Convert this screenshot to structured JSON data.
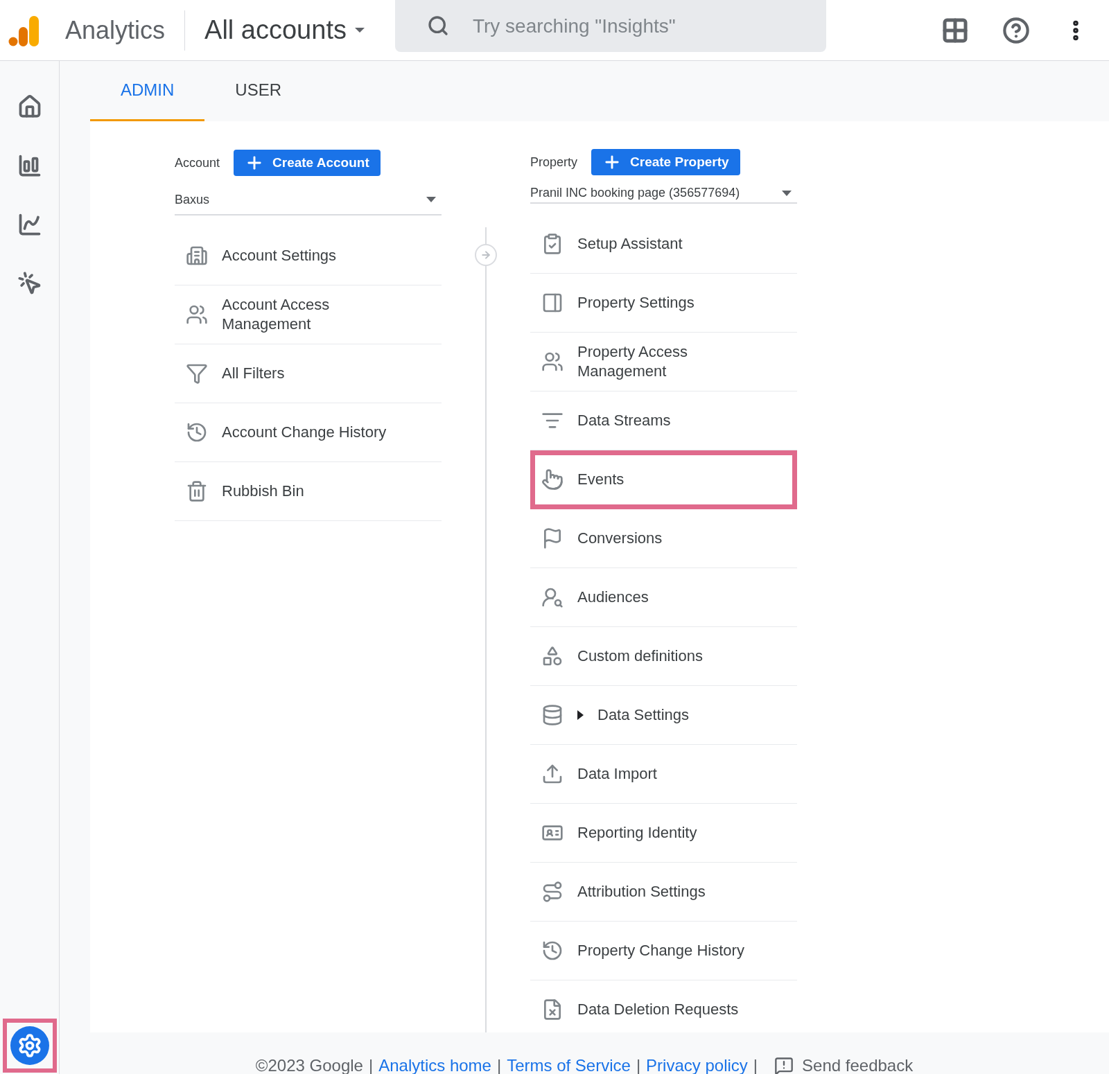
{
  "header": {
    "product": "Analytics",
    "account_picker": "All accounts",
    "search": {
      "placeholder": "Try searching \"Insights\""
    }
  },
  "sidebar": {
    "items": [
      {
        "kind": "home",
        "selected": false
      },
      {
        "kind": "reports",
        "selected": false
      },
      {
        "kind": "explore",
        "selected": false
      },
      {
        "kind": "advertising",
        "selected": false
      }
    ],
    "settings": {
      "selected": true,
      "highlighted": true
    }
  },
  "tabs": [
    {
      "label": "ADMIN",
      "selected": true
    },
    {
      "label": "USER",
      "selected": false
    }
  ],
  "account": {
    "label": "Account",
    "button": "Create Account",
    "selected_value": "Baxus",
    "items": [
      {
        "label": "Account Settings",
        "kind": "building",
        "highlighted": false
      },
      {
        "label": "Account Access Management",
        "kind": "people",
        "highlighted": false
      },
      {
        "label": "All Filters",
        "kind": "filter",
        "highlighted": false
      },
      {
        "label": "Account Change History",
        "kind": "history",
        "highlighted": false
      },
      {
        "label": "Rubbish Bin",
        "kind": "trash",
        "highlighted": false
      }
    ]
  },
  "property": {
    "label": "Property",
    "button": "Create Property",
    "selected_value": "Pranil INC booking page (356577694)",
    "items": [
      {
        "label": "Setup Assistant",
        "kind": "clipboard",
        "highlighted": false
      },
      {
        "label": "Property Settings",
        "kind": "layout",
        "highlighted": false
      },
      {
        "label": "Property Access Management",
        "kind": "people",
        "highlighted": false
      },
      {
        "label": "Data Streams",
        "kind": "streams",
        "highlighted": false
      },
      {
        "label": "Events",
        "kind": "touch",
        "highlighted": true
      },
      {
        "label": "Conversions",
        "kind": "flag",
        "highlighted": false
      },
      {
        "label": "Audiences",
        "kind": "audience",
        "highlighted": false
      },
      {
        "label": "Custom definitions",
        "kind": "shapes",
        "highlighted": false
      },
      {
        "label": "Data Settings",
        "kind": "database",
        "highlighted": false,
        "expanded": false
      },
      {
        "label": "Data Import",
        "kind": "upload",
        "highlighted": false
      },
      {
        "label": "Reporting Identity",
        "kind": "identity",
        "highlighted": false
      },
      {
        "label": "Attribution Settings",
        "kind": "route",
        "highlighted": false
      },
      {
        "label": "Property Change History",
        "kind": "history",
        "highlighted": false
      },
      {
        "label": "Data Deletion Requests",
        "kind": "deletion",
        "highlighted": false
      }
    ]
  },
  "footer": [
    {
      "kind": "text",
      "text": "©2023 Google"
    },
    {
      "kind": "sep",
      "text": "|"
    },
    {
      "kind": "link",
      "text": "Analytics home"
    },
    {
      "kind": "sep",
      "text": "|"
    },
    {
      "kind": "link",
      "text": "Terms of Service"
    },
    {
      "kind": "sep",
      "text": "|"
    },
    {
      "kind": "link",
      "text": "Privacy policy"
    },
    {
      "kind": "sep",
      "text": "|"
    },
    {
      "kind": "feedback",
      "text": "Send feedback"
    }
  ]
}
